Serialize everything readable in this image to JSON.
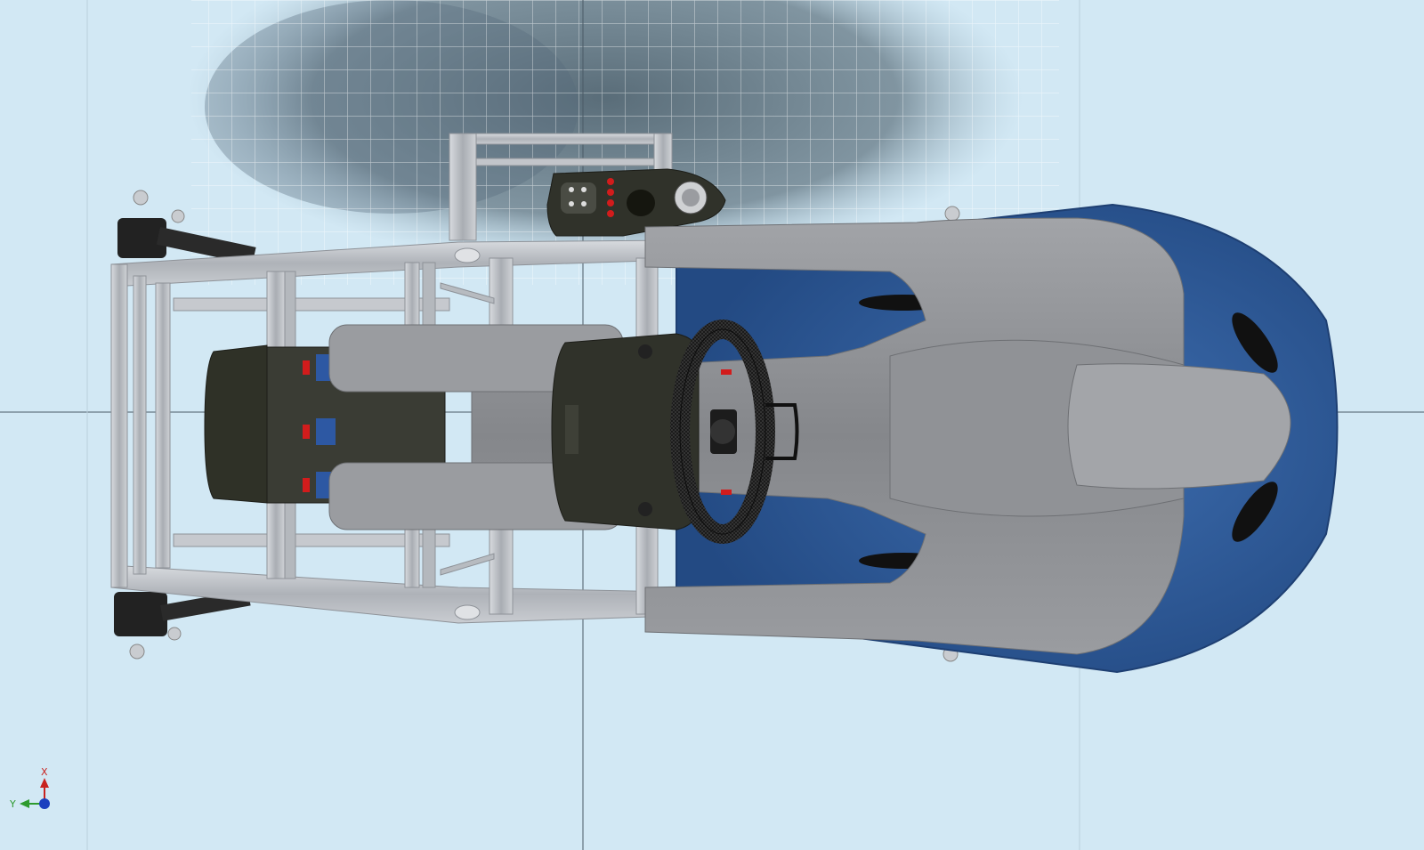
{
  "viewport": {
    "background": "#d2e8f4",
    "grid_color": "#ffffff",
    "floor_shadow": "#5f7380"
  },
  "model": {
    "frame_color": "#b9bdc3",
    "seat_shell_color": "#2f5c9a",
    "cushion_color": "#8c8e92",
    "device_color": "#2f3127",
    "accent_red": "#d21c1c"
  },
  "triad": {
    "x_label": "X",
    "y_label": "Y",
    "x_color": "#c8231f",
    "y_color": "#2e9a2e",
    "z_color": "#1b3fbf"
  }
}
